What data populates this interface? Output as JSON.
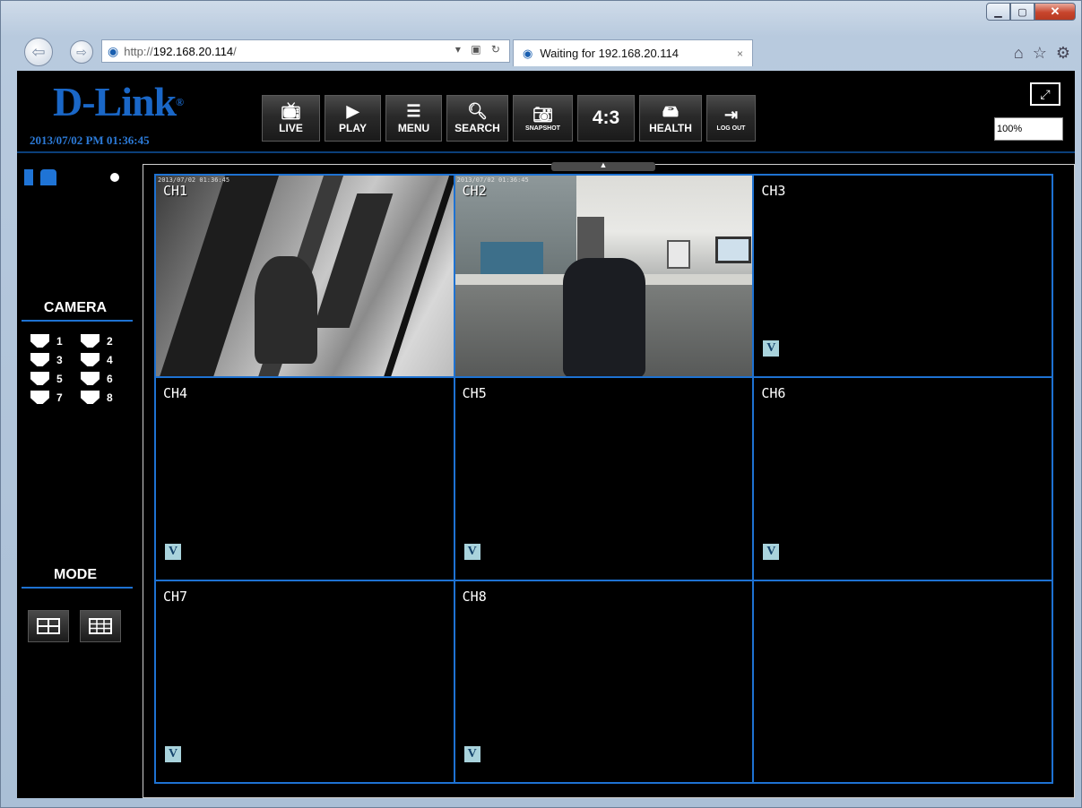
{
  "browser": {
    "address_scheme": "http://",
    "address_host": "192.168.20.114",
    "address_suffix": "/",
    "tab_title": "Waiting for 192.168.20.114",
    "tab_close": "×"
  },
  "app": {
    "brand": "D-Link",
    "datetime": "2013/07/02 PM 01:36:45",
    "toolbar": [
      {
        "name": "live",
        "label": "LIVE",
        "icon": "tv-icon"
      },
      {
        "name": "play",
        "label": "PLAY",
        "icon": "play-icon"
      },
      {
        "name": "menu",
        "label": "MENU",
        "icon": "menu-icon"
      },
      {
        "name": "search",
        "label": "SEARCH",
        "icon": "search-doc-icon"
      },
      {
        "name": "snapshot",
        "label": "SNAPSHOT",
        "icon": "camera-icon"
      },
      {
        "name": "ratio",
        "label": "4:3",
        "icon": ""
      },
      {
        "name": "health",
        "label": "HEALTH",
        "icon": "hdd-icon"
      },
      {
        "name": "logout",
        "label": "LOG OUT",
        "icon": "logout-icon"
      }
    ],
    "zoom": "100%",
    "sidebar": {
      "camera_title": "CAMERA",
      "cameras": [
        "1",
        "2",
        "3",
        "4",
        "5",
        "6",
        "7",
        "8"
      ],
      "mode_title": "MODE"
    },
    "channels": [
      {
        "label": "CH1",
        "feed": true,
        "vloss": false,
        "osd": "2013/07/02 01:36:45"
      },
      {
        "label": "CH2",
        "feed": true,
        "vloss": false,
        "osd": "2013/07/02 01:36:45"
      },
      {
        "label": "CH3",
        "feed": false,
        "vloss": true
      },
      {
        "label": "CH4",
        "feed": false,
        "vloss": true
      },
      {
        "label": "CH5",
        "feed": false,
        "vloss": true
      },
      {
        "label": "CH6",
        "feed": false,
        "vloss": true
      },
      {
        "label": "CH7",
        "feed": false,
        "vloss": true
      },
      {
        "label": "CH8",
        "feed": false,
        "vloss": true
      },
      {
        "label": "",
        "feed": false,
        "vloss": false
      }
    ],
    "vloss_badge": "V",
    "colors": {
      "accent": "#1e72d2",
      "brand": "#1a67c7",
      "badge": "#a9d3dc"
    }
  }
}
